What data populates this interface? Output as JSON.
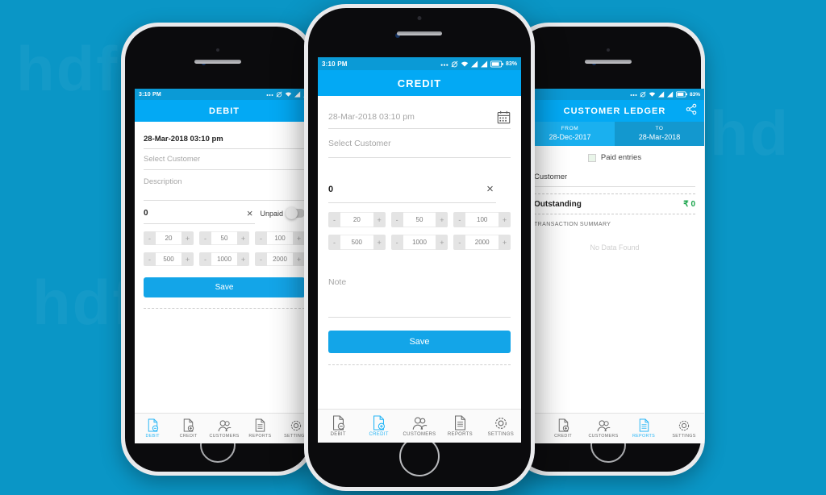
{
  "background": {
    "color": "#0a96c6",
    "watermark": "hdfc"
  },
  "statusbar": {
    "time": "3:10 PM",
    "battery_pct": "83%",
    "icons": [
      "more-dots-icon",
      "alarm-off-icon",
      "wifi-icon",
      "signal-icon",
      "signal-icon",
      "battery-icon"
    ]
  },
  "common": {
    "save_label": "Save",
    "quick_amounts_row1": [
      "20",
      "50",
      "100"
    ],
    "quick_amounts_row2": [
      "500",
      "1000",
      "2000"
    ],
    "minus": "-",
    "plus": "+",
    "clear": "×"
  },
  "nav": {
    "debit": "DEBIT",
    "credit": "CREDIT",
    "customers": "CUSTOMERS",
    "reports": "REPORTS",
    "settings": "SETTINGS"
  },
  "phone_left": {
    "title": "DEBIT",
    "date_value": "28-Mar-2018 03:10 pm",
    "customer_placeholder": "Select Customer",
    "description_placeholder": "Description",
    "amount_value": "0",
    "toggle_label": "Unpaid",
    "active_nav": "DEBIT"
  },
  "phone_center": {
    "title": "CREDIT",
    "date_placeholder": "28-Mar-2018 03:10 pm",
    "customer_placeholder": "Select Customer",
    "amount_value": "0",
    "note_placeholder": "Note",
    "active_nav": "CREDIT",
    "calendar_icon": "calendar-icon"
  },
  "phone_right": {
    "title": "CUSTOMER LEDGER",
    "share_icon": "share-icon",
    "from_label": "FROM",
    "from_value": "28-Dec-2017",
    "to_label": "TO",
    "to_value": "28-Mar-2018",
    "paid_entries_label": "Paid entries",
    "customer_label": "Customer",
    "outstanding_label": "Outstanding",
    "outstanding_value": "₹ 0",
    "outstanding_color": "#19a34a",
    "summary_title": "TRANSACTION SUMMARY",
    "no_data": "No Data Found",
    "active_nav": "REPORTS"
  }
}
